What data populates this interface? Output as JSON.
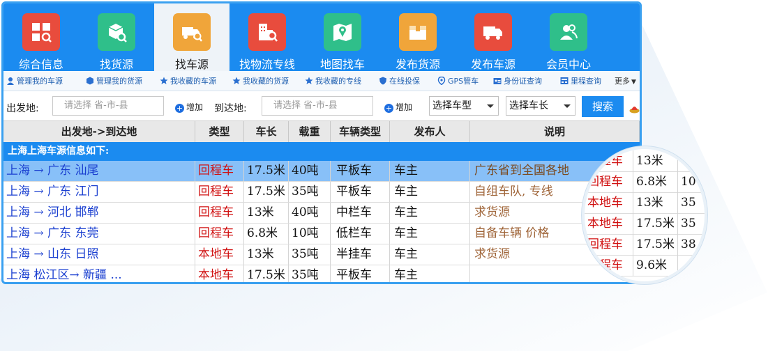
{
  "nav": {
    "items": [
      {
        "label": "综合信息",
        "icon": "info-icon",
        "color": "#e84c3d"
      },
      {
        "label": "找货源",
        "icon": "cargo-search-icon",
        "color": "#2fbf8a"
      },
      {
        "label": "找车源",
        "icon": "truck-search-icon",
        "color": "#f0a53a"
      },
      {
        "label": "找物流专线",
        "icon": "building-search-icon",
        "color": "#e84c3d"
      },
      {
        "label": "地图找车",
        "icon": "map-icon",
        "color": "#2fbf8a"
      },
      {
        "label": "发布货源",
        "icon": "box-icon",
        "color": "#f0a53a"
      },
      {
        "label": "发布车源",
        "icon": "truck-icon",
        "color": "#e84c3d"
      },
      {
        "label": "会员中心",
        "icon": "members-icon",
        "color": "#2fbf8a"
      }
    ],
    "active_index": 2
  },
  "subnav": {
    "items": [
      {
        "label": "管理我的车源",
        "icon": "user-icon"
      },
      {
        "label": "管理我的货源",
        "icon": "cube-icon"
      },
      {
        "label": "我收藏的车源",
        "icon": "star-icon"
      },
      {
        "label": "我收藏的货源",
        "icon": "star-icon"
      },
      {
        "label": "我收藏的专线",
        "icon": "star-icon"
      },
      {
        "label": "在线投保",
        "icon": "shield-icon"
      },
      {
        "label": "GPS管车",
        "icon": "location-pin-icon"
      },
      {
        "label": "身份证查询",
        "icon": "id-card-icon"
      },
      {
        "label": "里程查询",
        "icon": "odometer-icon"
      }
    ],
    "more_label": "更多"
  },
  "search": {
    "from_label": "出发地:",
    "from_placeholder": "请选择 省-市-县",
    "add_label": "增加",
    "to_label": "到达地:",
    "to_placeholder": "请选择 省-市-县",
    "add_label_2": "增加",
    "vehicle_type": "选择车型",
    "vehicle_length": "选择车长",
    "search_button": "搜索"
  },
  "table": {
    "headers": [
      "出发地->到达地",
      "类型",
      "车长",
      "载重",
      "车辆类型",
      "发布人",
      "说明"
    ],
    "caption": "上海上海车源信息如下:",
    "rows": [
      {
        "route": "上海 → 广东 汕尾",
        "type": "回程车",
        "length": "17.5米",
        "load": "40吨",
        "vehicle": "平板车",
        "publisher": "车主",
        "note": "广东省到全国各地"
      },
      {
        "route": "上海 → 广东 江门",
        "type": "回程车",
        "length": "17.5米",
        "load": "35吨",
        "vehicle": "平板车",
        "publisher": "车主",
        "note": "自组车队, 专线"
      },
      {
        "route": "上海 → 河北 邯郸",
        "type": "回程车",
        "length": "13米",
        "load": "40吨",
        "vehicle": "中栏车",
        "publisher": "车主",
        "note": "求货源"
      },
      {
        "route": "上海 → 广东 东莞",
        "type": "回程车",
        "length": "6.8米",
        "load": "10吨",
        "vehicle": "低栏车",
        "publisher": "车主",
        "note": "自备车辆 价格"
      },
      {
        "route": "上海 → 山东 日照",
        "type": "本地车",
        "length": "13米",
        "load": "35吨",
        "vehicle": "半挂车",
        "publisher": "车主",
        "note": "求货源"
      },
      {
        "route": "上海 松江区→ 新疆 ...",
        "type": "本地车",
        "length": "17.5米",
        "load": "35吨",
        "vehicle": "平板车",
        "publisher": "车主",
        "note": ""
      }
    ]
  },
  "magnifier": {
    "rows": [
      {
        "type": "回程车",
        "length": "13米",
        "load": ""
      },
      {
        "type": "回程车",
        "length": "6.8米",
        "load": "10"
      },
      {
        "type": "本地车",
        "length": "13米",
        "load": "35"
      },
      {
        "type": "本地车",
        "length": "17.5米",
        "load": "35"
      },
      {
        "type": "回程车",
        "length": "17.5米",
        "load": "38"
      },
      {
        "type": "回程车",
        "length": "9.6米",
        "load": ""
      }
    ]
  },
  "colors": {
    "brand_blue": "#1b8bf0",
    "route_text": "#1a3fd0",
    "type_text": "#d01010",
    "note_text": "#a0663a",
    "selected_row": "#88c0f8"
  }
}
